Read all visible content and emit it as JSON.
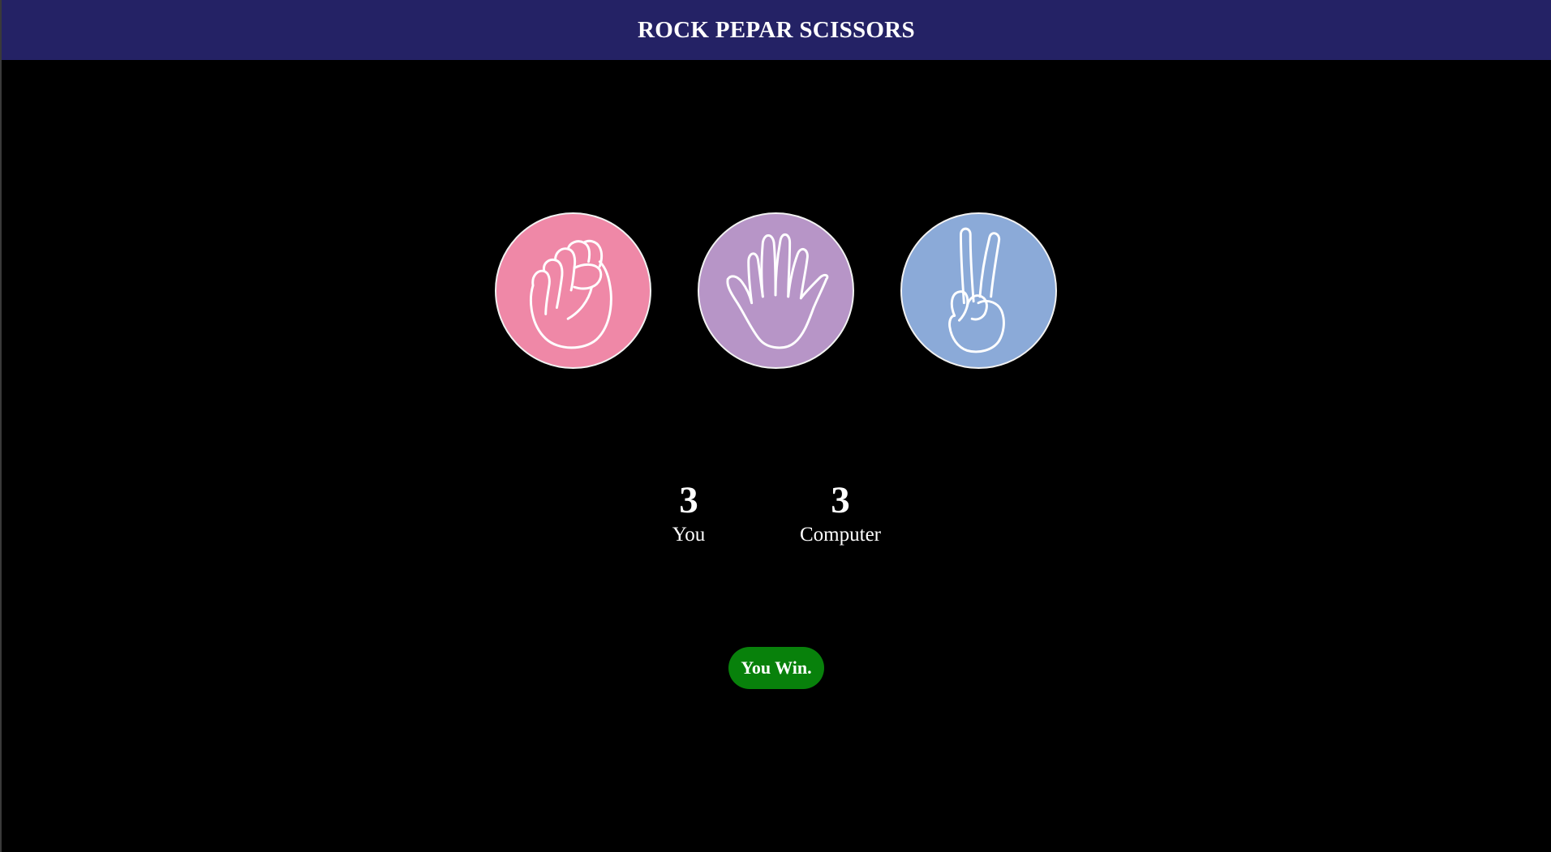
{
  "header": {
    "title": "ROCK PEPAR SCISSORS",
    "background_color": "#242265"
  },
  "choices": [
    {
      "name": "rock",
      "icon": "fist-icon",
      "color": "#ef88a7"
    },
    {
      "name": "paper",
      "icon": "open-hand-icon",
      "color": "#b795c7"
    },
    {
      "name": "scissors",
      "icon": "peace-sign-icon",
      "color": "#8baad8"
    }
  ],
  "scoreboard": {
    "you": {
      "score": "3",
      "label": "You"
    },
    "computer": {
      "score": "3",
      "label": "Computer"
    }
  },
  "result": {
    "message": "You Win.",
    "color": "#08810b"
  }
}
